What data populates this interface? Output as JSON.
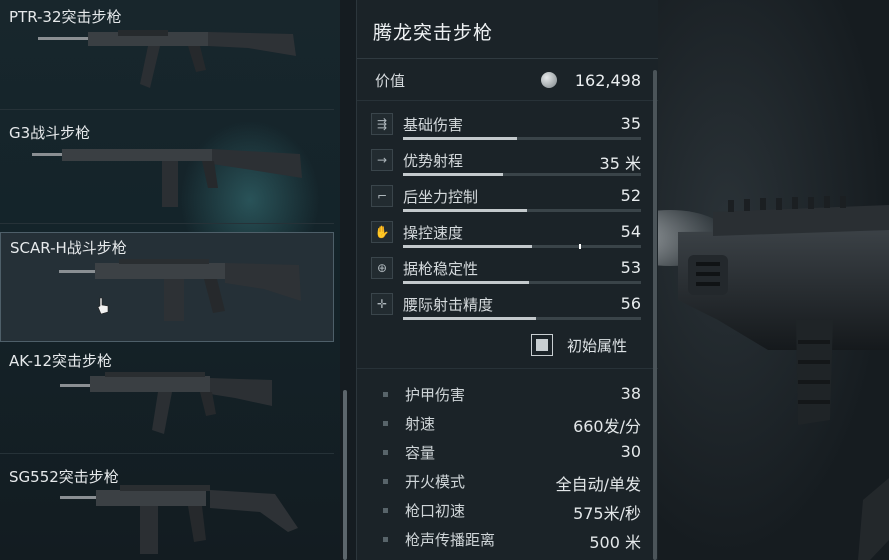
{
  "weapon_list": [
    {
      "name": "PTR-32突击步枪"
    },
    {
      "name": "G3战斗步枪"
    },
    {
      "name": "SCAR-H战斗步枪"
    },
    {
      "name": "AK-12突击步枪"
    },
    {
      "name": "SG552突击步枪"
    }
  ],
  "panel": {
    "title": "腾龙突击步枪",
    "value_label": "价值",
    "value": "162,498",
    "stats": [
      {
        "label": "基础伤害",
        "value": "35",
        "icon": "damage-icon",
        "fill": 0.48
      },
      {
        "label": "优势射程",
        "value": "35 米",
        "icon": "range-icon",
        "fill": 0.42
      },
      {
        "label": "后坐力控制",
        "value": "52",
        "icon": "recoil-icon",
        "fill": 0.52
      },
      {
        "label": "操控速度",
        "value": "54",
        "icon": "handling-icon",
        "fill": 0.54
      },
      {
        "label": "据枪稳定性",
        "value": "53",
        "icon": "stability-icon",
        "fill": 0.53
      },
      {
        "label": "腰际射击精度",
        "value": "56",
        "icon": "hipfire-icon",
        "fill": 0.56
      }
    ],
    "toggle_label": "初始属性",
    "attributes": [
      {
        "label": "护甲伤害",
        "value": "38"
      },
      {
        "label": "射速",
        "value": "660发/分"
      },
      {
        "label": "容量",
        "value": "30"
      },
      {
        "label": "开火模式",
        "value": "全自动/单发"
      },
      {
        "label": "枪口初速",
        "value": "575米/秒"
      },
      {
        "label": "枪声传播距离",
        "value": "500 米"
      }
    ]
  },
  "colors": {
    "accent": "#c3c9cc",
    "panel_bg": "#1b2328",
    "selected_bg": "#253037"
  }
}
